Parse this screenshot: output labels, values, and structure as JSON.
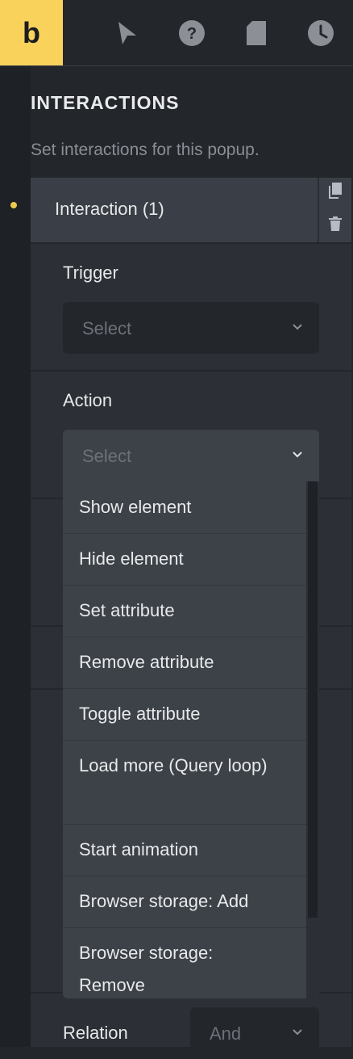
{
  "logo": {
    "letter": "b"
  },
  "toolbar": {
    "icons": [
      "cursor-icon",
      "help-icon",
      "page-icon",
      "history-icon"
    ]
  },
  "section": {
    "title": "INTERACTIONS",
    "subtitle": "Set interactions for this popup."
  },
  "interaction": {
    "header": "Interaction (1)",
    "actions": [
      "copy-icon",
      "trash-icon"
    ],
    "trigger": {
      "label": "Trigger",
      "placeholder": "Select"
    },
    "action": {
      "label": "Action",
      "placeholder": "Select"
    },
    "relation": {
      "label": "Relation",
      "value": "And"
    }
  },
  "dropdown": {
    "options": [
      "Show element",
      "Hide element",
      "Set attribute",
      "Remove attribute",
      "Toggle attribute",
      "Load more (Query loop)",
      "Start animation",
      "Browser storage: Add",
      "Browser storage: Remove"
    ]
  },
  "colors": {
    "accent": "#f8d25a",
    "background": "#23262b",
    "panel": "#2c3036",
    "header": "#3a3f47"
  }
}
